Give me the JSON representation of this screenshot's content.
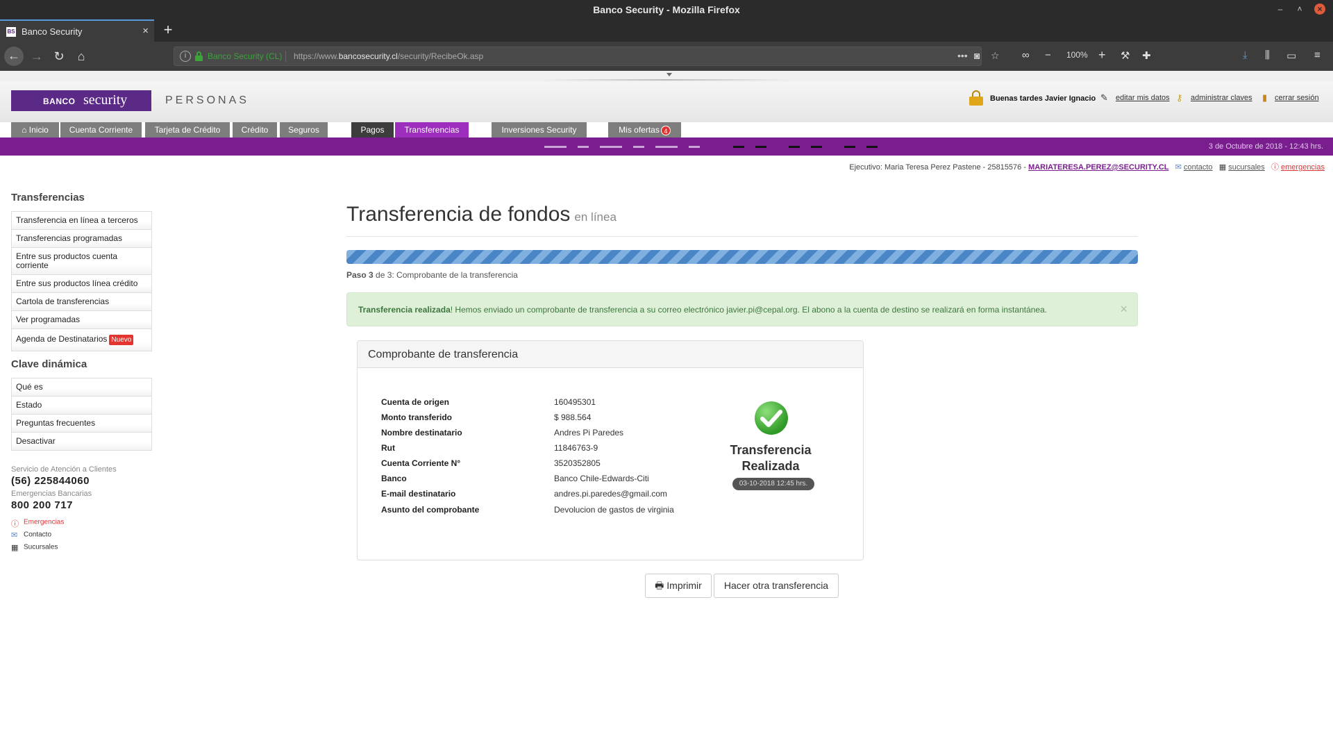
{
  "browser": {
    "window_title": "Banco Security - Mozilla Firefox",
    "tab_title": "Banco Security",
    "favicon_text": "BS",
    "site_identity": "Banco Security (CL)",
    "url_prefix": "https://www.",
    "url_domain": "bancosecurity.cl",
    "url_path": "/security/RecibeOk.asp",
    "zoom": "100%"
  },
  "header": {
    "logo_banco": "BANCO",
    "logo_security": "security",
    "section": "PERSONAS",
    "greeting": "Buenas tardes Javier Ignacio",
    "links": [
      "editar mis datos",
      "administrar claves",
      "cerrar sesión"
    ]
  },
  "nav": {
    "items": [
      "Inicio",
      "Cuenta Corriente",
      "Tarjeta de Crédito",
      "Crédito",
      "Seguros",
      "Pagos",
      "Transferencias",
      "Inversiones Security",
      "Mis ofertas"
    ],
    "offers_count": "4",
    "active": "Transferencias",
    "date": "3 de Octubre de 2018 - 12:43 hrs."
  },
  "executive": {
    "label": "Ejecutivo: Maria Teresa Perez Pastene - 25815576 -",
    "email": "MARIATERESA.PEREZ@SECURITY.CL",
    "links": [
      "contacto",
      "sucursales",
      "emergencias"
    ]
  },
  "sidebar": {
    "section1_title": "Transferencias",
    "section1_items": [
      "Transferencia en línea a terceros",
      "Transferencias programadas",
      "Entre sus productos cuenta corriente",
      "Entre sus productos línea crédito",
      "Cartola de transferencias",
      "Ver programadas",
      "Agenda de Destinatarios"
    ],
    "new_badge": "Nuevo",
    "section2_title": "Clave dinámica",
    "section2_items": [
      "Qué es",
      "Estado",
      "Preguntas frecuentes",
      "Desactivar"
    ],
    "service_label": "Servicio de Atención a Clientes",
    "service_phone": "(56) 225844060",
    "emergency_label": "Emergencias Bancarias",
    "emergency_phone": "800 200 717",
    "footer_links": [
      "Emergencias",
      "Contacto",
      "Sucursales"
    ]
  },
  "main": {
    "title": "Transferencia de fondos",
    "subtitle": "en línea",
    "progress_fraction": 1.0,
    "step_bold": "Paso 3",
    "step_rest": " de 3: Comprobante de la transferencia",
    "alert_bold": "Transferencia realizada",
    "alert_text": "! Hemos enviado un comprobante de transferencia a su correo electrónico javier.pi@cepal.org. El abono a la cuenta de destino se realizará en forma instantánea.",
    "alert_close": "×",
    "receipt_title": "Comprobante de transferencia",
    "receipt": [
      {
        "label": "Cuenta de origen",
        "value": "160495301"
      },
      {
        "label": "Monto transferido",
        "value": "$ 988.564"
      },
      {
        "label": "Nombre destinatario",
        "value": "Andres Pi Paredes"
      },
      {
        "label": "Rut",
        "value": "11846763-9"
      },
      {
        "label": "Cuenta Corriente N°",
        "value": "3520352805"
      },
      {
        "label": "Banco",
        "value": "Banco Chile-Edwards-Citi"
      },
      {
        "label": "E-mail destinatario",
        "value": "andres.pi.paredes@gmail.com"
      },
      {
        "label": "Asunto del comprobante",
        "value": "Devolucion de gastos de virginia"
      }
    ],
    "status_line1": "Transferencia",
    "status_line2": "Realizada",
    "status_date": "03-10-2018 12:45 hrs.",
    "print_button": "Imprimir",
    "again_button": "Hacer otra transferencia"
  },
  "colors": {
    "brand_purple": "#5b2a86",
    "nav_active": "#9c2dbd",
    "purple_bar": "#7a1e8f",
    "success_bg": "#dff0d8",
    "success_text": "#3c763d"
  }
}
